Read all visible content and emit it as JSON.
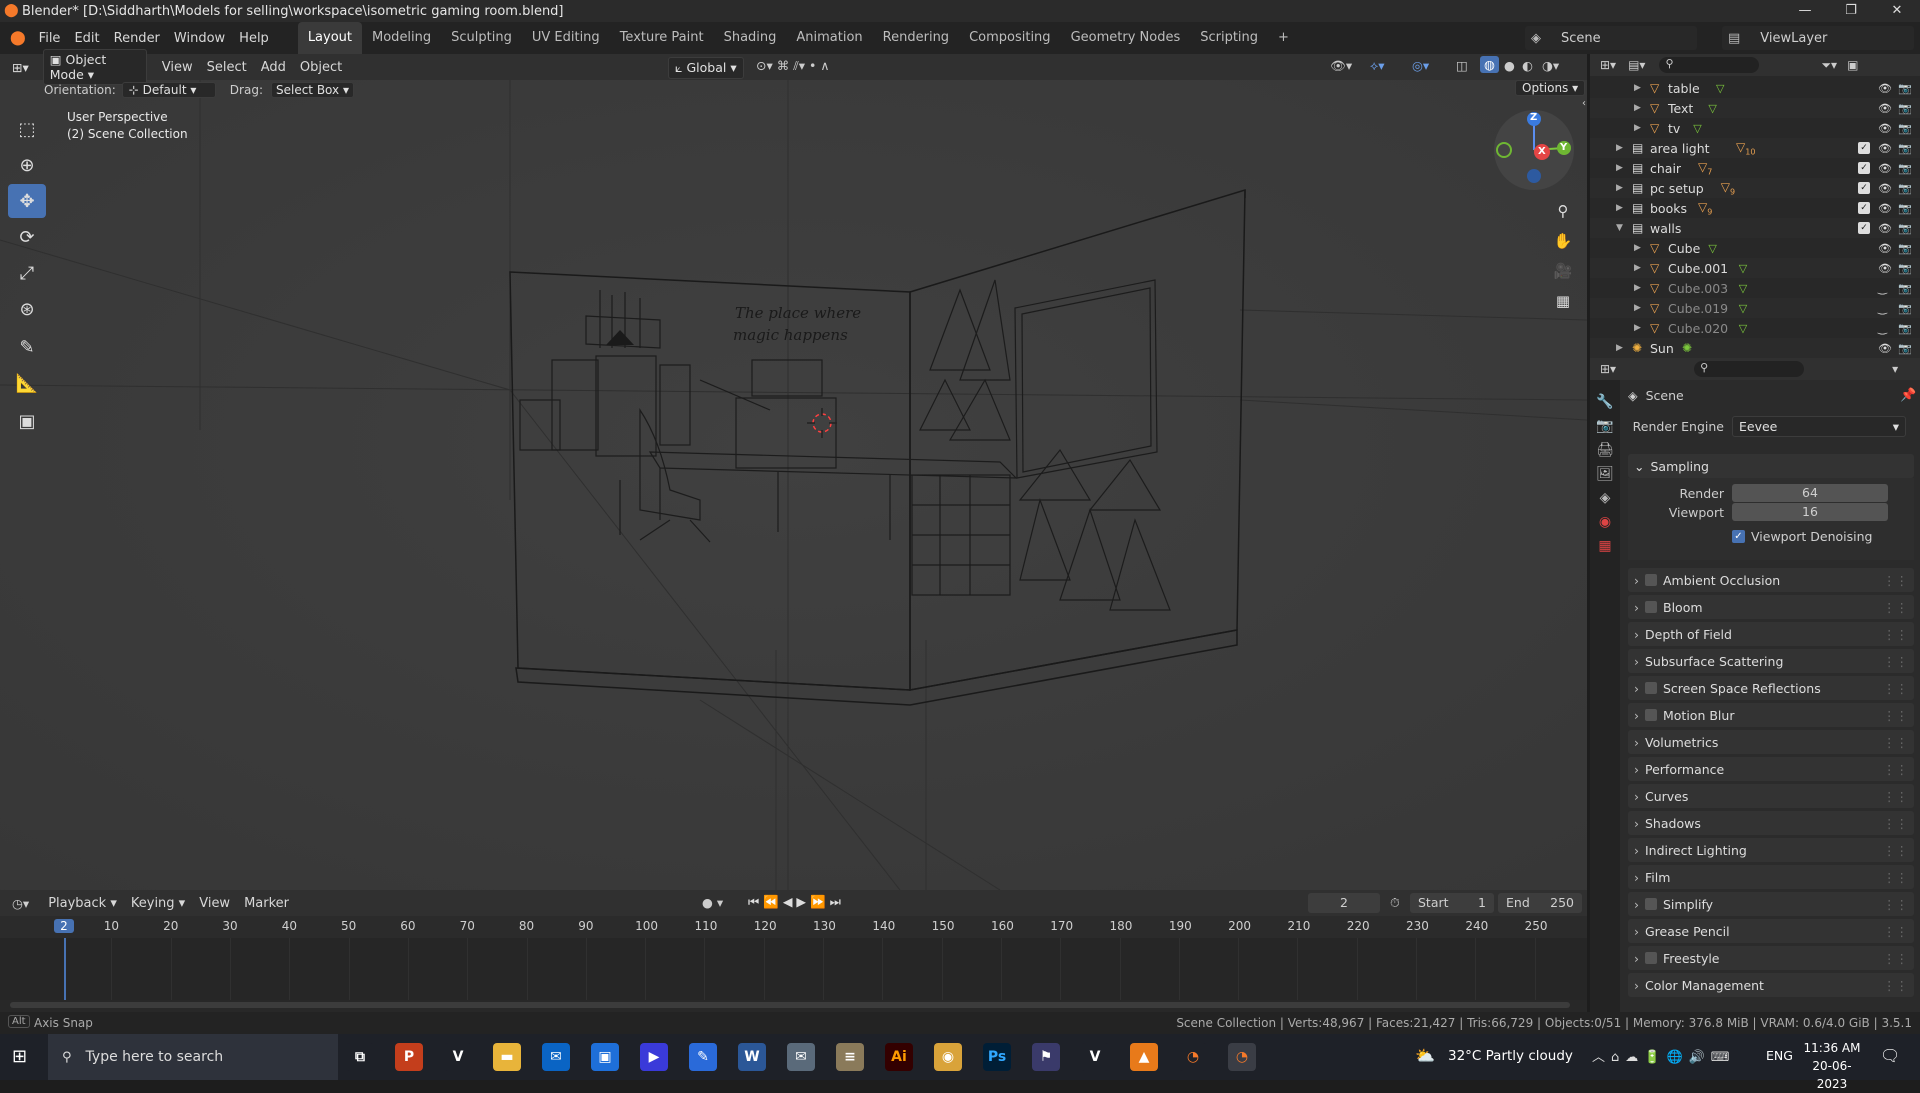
{
  "window": {
    "title": "Blender* [D:\\Siddharth\\Models for selling\\workspace\\isometric gaming room.blend]"
  },
  "menus": [
    "File",
    "Edit",
    "Render",
    "Window",
    "Help"
  ],
  "workspace_tabs": [
    "Layout",
    "Modeling",
    "Sculpting",
    "UV Editing",
    "Texture Paint",
    "Shading",
    "Animation",
    "Rendering",
    "Compositing",
    "Geometry Nodes",
    "Scripting"
  ],
  "scene": {
    "label": "Scene",
    "view_layer": "ViewLayer"
  },
  "viewport_header": {
    "mode": "Object Mode",
    "menus": [
      "View",
      "Select",
      "Add",
      "Object"
    ],
    "transform_orientation": "Global",
    "orientation_label": "Orientation:",
    "orientation_value": "Default",
    "drag_label": "Drag:",
    "drag_value": "Select Box",
    "options": "Options"
  },
  "viewport_overlay": {
    "perspective": "User Perspective",
    "collection": "(2) Scene Collection",
    "neon_text_line1": "The place where",
    "neon_text_line2": "magic happens"
  },
  "gizmo": {
    "z": "Z",
    "x": "X",
    "y": "Y"
  },
  "outliner": {
    "rows": [
      {
        "name": "table",
        "indent": 2,
        "dim": false,
        "checkbox": false
      },
      {
        "name": "Text",
        "indent": 2,
        "dim": false,
        "checkbox": false
      },
      {
        "name": "tv",
        "indent": 2,
        "dim": false,
        "checkbox": false
      },
      {
        "name": "area light",
        "indent": 1,
        "dim": false,
        "checkbox": true,
        "badge": "10"
      },
      {
        "name": "chair",
        "indent": 1,
        "dim": false,
        "checkbox": true,
        "badge": "7"
      },
      {
        "name": "pc setup",
        "indent": 1,
        "dim": false,
        "checkbox": true,
        "badge": "9"
      },
      {
        "name": "books",
        "indent": 1,
        "dim": false,
        "checkbox": true,
        "badge": "9"
      },
      {
        "name": "walls",
        "indent": 1,
        "dim": false,
        "checkbox": true
      },
      {
        "name": "Cube",
        "indent": 2,
        "dim": false,
        "checkbox": false
      },
      {
        "name": "Cube.001",
        "indent": 2,
        "dim": false,
        "checkbox": false
      },
      {
        "name": "Cube.003",
        "indent": 2,
        "dim": true,
        "checkbox": false
      },
      {
        "name": "Cube.019",
        "indent": 2,
        "dim": true,
        "checkbox": false
      },
      {
        "name": "Cube.020",
        "indent": 2,
        "dim": true,
        "checkbox": false
      },
      {
        "name": "Sun",
        "indent": 1,
        "dim": false,
        "checkbox": false
      }
    ]
  },
  "properties": {
    "context": "Scene",
    "render_engine_label": "Render Engine",
    "render_engine": "Eevee",
    "sampling": {
      "label": "Sampling",
      "render_label": "Render",
      "render": "64",
      "viewport_label": "Viewport",
      "viewport": "16",
      "denoise": "Viewport Denoising"
    },
    "panels": [
      {
        "label": "Ambient Occlusion",
        "checkbox": true
      },
      {
        "label": "Bloom",
        "checkbox": true
      },
      {
        "label": "Depth of Field",
        "checkbox": false
      },
      {
        "label": "Subsurface Scattering",
        "checkbox": false
      },
      {
        "label": "Screen Space Reflections",
        "checkbox": true
      },
      {
        "label": "Motion Blur",
        "checkbox": true
      },
      {
        "label": "Volumetrics",
        "checkbox": false
      },
      {
        "label": "Performance",
        "checkbox": false
      },
      {
        "label": "Curves",
        "checkbox": false
      },
      {
        "label": "Shadows",
        "checkbox": false
      },
      {
        "label": "Indirect Lighting",
        "checkbox": false
      },
      {
        "label": "Film",
        "checkbox": false
      },
      {
        "label": "Simplify",
        "checkbox": true
      },
      {
        "label": "Grease Pencil",
        "checkbox": false
      },
      {
        "label": "Freestyle",
        "checkbox": true
      },
      {
        "label": "Color Management",
        "checkbox": false
      }
    ]
  },
  "timeline": {
    "menus": [
      "Playback",
      "Keying",
      "View",
      "Marker"
    ],
    "current_frame": "2",
    "start_label": "Start",
    "start": "1",
    "end_label": "End",
    "end": "250",
    "ruler": [
      "2",
      "10",
      "20",
      "30",
      "40",
      "50",
      "60",
      "70",
      "80",
      "90",
      "100",
      "110",
      "120",
      "130",
      "140",
      "150",
      "160",
      "170",
      "180",
      "190",
      "200",
      "210",
      "220",
      "230",
      "240",
      "250"
    ]
  },
  "statusbar": {
    "key": "Alt",
    "hint": "Axis Snap",
    "stats": "Scene Collection | Verts:48,967 | Faces:21,427 | Tris:66,729 | Objects:0/51 | Memory: 376.8 MiB | VRAM: 0.6/4.0 GiB | 3.5.1"
  },
  "taskbar": {
    "search_placeholder": "Type here to search",
    "weather": "32°C  Partly cloudy",
    "lang": "ENG",
    "time": "11:36 AM",
    "date": "20-06-2023",
    "apps": [
      "task-view",
      "powerpoint",
      "vs",
      "explorer",
      "outlook",
      "store",
      "media",
      "editor",
      "word",
      "mail",
      "files",
      "illustrator",
      "chrome",
      "photoshop",
      "pin",
      "vs2",
      "vlc",
      "blender-orange",
      "blender"
    ]
  }
}
